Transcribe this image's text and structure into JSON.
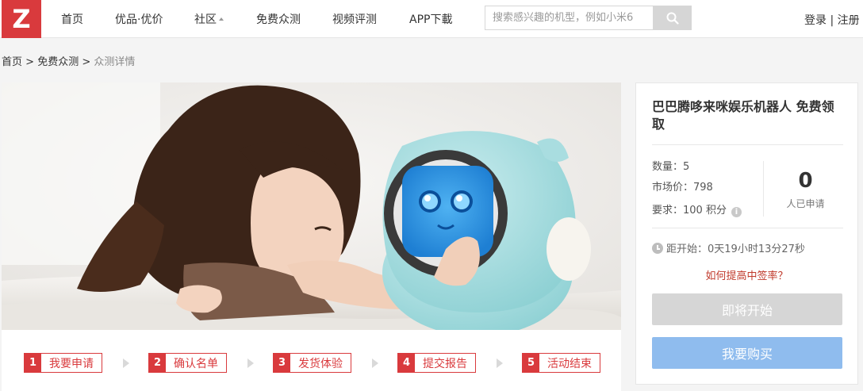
{
  "header": {
    "logo": "Z",
    "nav": [
      {
        "label": "首页"
      },
      {
        "label": "优品·优价"
      },
      {
        "label": "社区"
      },
      {
        "label": "免费众测"
      },
      {
        "label": "视频评测"
      },
      {
        "label": "APP下載"
      }
    ],
    "search_placeholder": "搜索感兴趣的机型，例如小米6",
    "login": "登录",
    "separator": "|",
    "register": "注册"
  },
  "breadcrumb": {
    "home": "首页",
    "sep1": ">",
    "section": "免费众测",
    "sep2": ">",
    "current": "众测详情"
  },
  "steps": [
    {
      "num": "1",
      "label": "我要申请"
    },
    {
      "num": "2",
      "label": "确认名单"
    },
    {
      "num": "3",
      "label": "发货体验"
    },
    {
      "num": "4",
      "label": "提交报告"
    },
    {
      "num": "5",
      "label": "活动结束"
    }
  ],
  "side": {
    "title": "巴巴腾哆来咪娱乐机器人 免费领取",
    "quantity": "数量：5",
    "market_price": "市场价：798",
    "requirement": "要求：100 积分",
    "applicants_count": "0",
    "applicants_label": "人已申请",
    "countdown": "距开始：0天19小时13分27秒",
    "tip": "如何提高中签率？",
    "btn_start": "即将开始",
    "btn_buy": "我要购买"
  },
  "colors": {
    "brand": "#d93a3d",
    "buy_button": "#8fbcee",
    "disabled_button": "#d6d6d6"
  }
}
